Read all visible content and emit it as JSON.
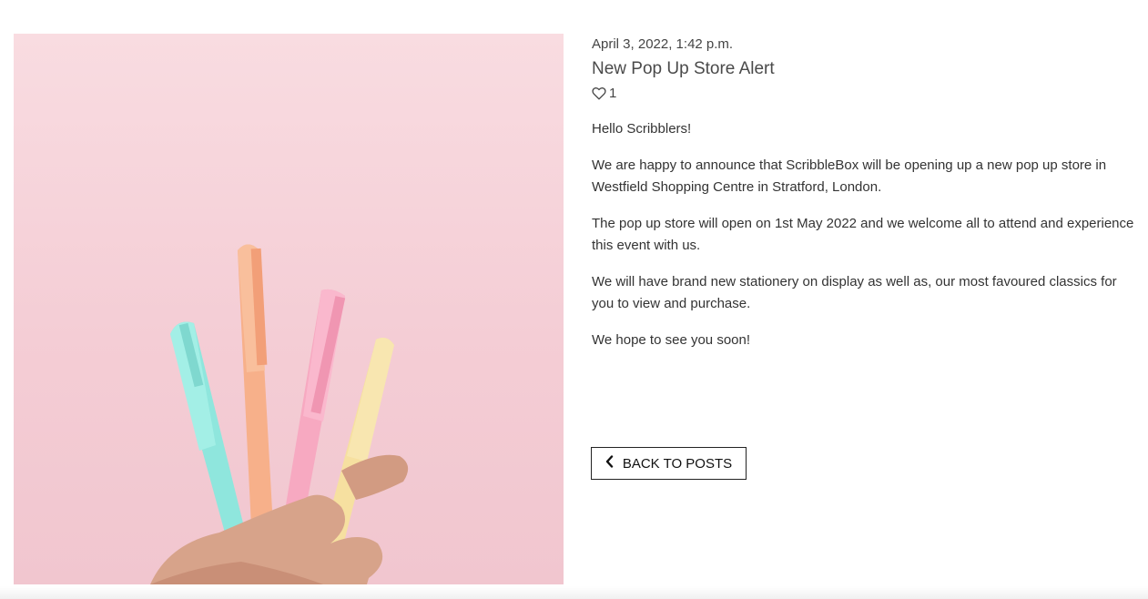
{
  "post": {
    "date": "April 3, 2022, 1:42 p.m.",
    "title": "New Pop Up Store Alert",
    "likes": "1",
    "paragraphs": [
      "Hello Scribblers!",
      "We are happy to announce that ScribbleBox will be opening up a new pop up store in Westfield Shopping Centre in Stratford, London.",
      "The pop up store will open on 1st May 2022 and we welcome all to attend and experience this event with us.",
      "We will have brand new stationery on display as well as, our most favoured classics for you to view and purchase.",
      "We hope to see you soon!"
    ]
  },
  "back_button": {
    "label": "BACK TO POSTS",
    "icon": "chevron-left-icon"
  },
  "icons": {
    "like": "heart-outline-icon"
  },
  "colors": {
    "image_background": "#f6d3da",
    "pen_turquoise": "#8fe6dd",
    "pen_peach": "#f7b08a",
    "pen_pink": "#f7a9c1",
    "pen_yellow": "#f6e0a0"
  }
}
